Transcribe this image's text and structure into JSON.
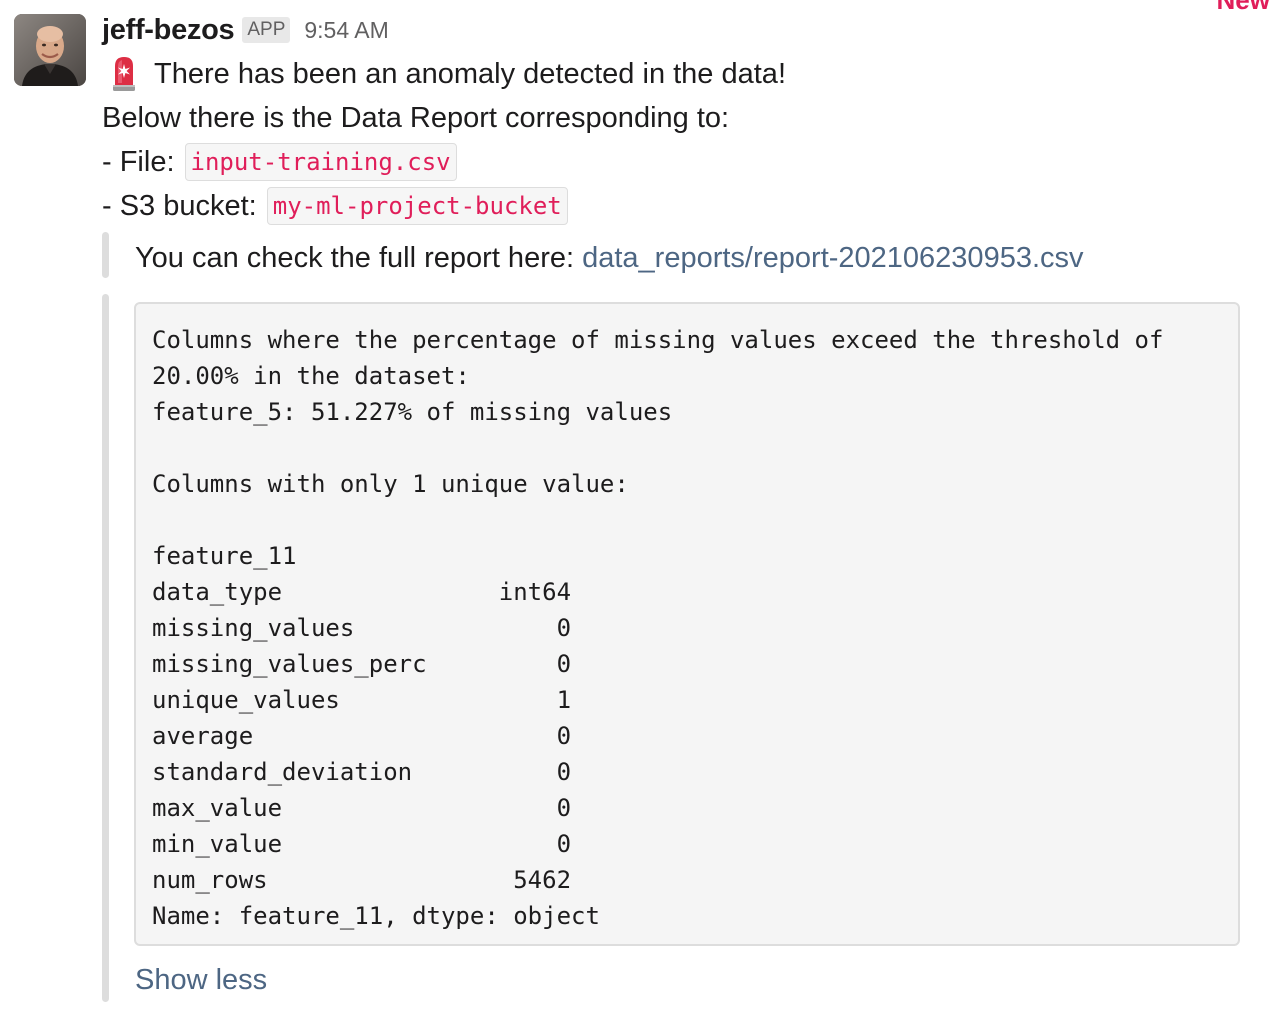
{
  "corner_badge": "New",
  "message": {
    "sender": "jeff-bezos",
    "app_badge": "APP",
    "time": "9:54 AM",
    "icons": {
      "avatar": "avatar-photo",
      "alert": "rotating-light-icon"
    },
    "lines": {
      "anomaly": "There has been an anomaly detected in the data!",
      "intro": "Below there is the Data Report corresponding to:",
      "file_label": "- File:",
      "file_value": "input-training.csv",
      "bucket_label": "- S3 bucket:",
      "bucket_value": "my-ml-project-bucket"
    }
  },
  "attachment": {
    "report_text": "You can check the full report here:",
    "report_link": "data_reports/report-202106230953.csv",
    "code_lines": [
      "Columns where the percentage of missing values exceed the threshold of",
      "20.00% in the dataset:",
      "feature_5: 51.227% of missing values",
      "",
      "Columns with only 1 unique value:",
      "",
      "feature_11",
      "data_type               int64",
      "missing_values              0",
      "missing_values_perc         0",
      "unique_values               1",
      "average                     0",
      "standard_deviation          0",
      "max_value                   0",
      "min_value                   0",
      "num_rows                 5462",
      "Name: feature_11, dtype: object"
    ],
    "show_less": "Show less"
  },
  "colors": {
    "accent_red": "#e01e5a",
    "link_blue": "#4d6683",
    "muted_gray": "#616061",
    "bar_gray": "#dddddd"
  }
}
